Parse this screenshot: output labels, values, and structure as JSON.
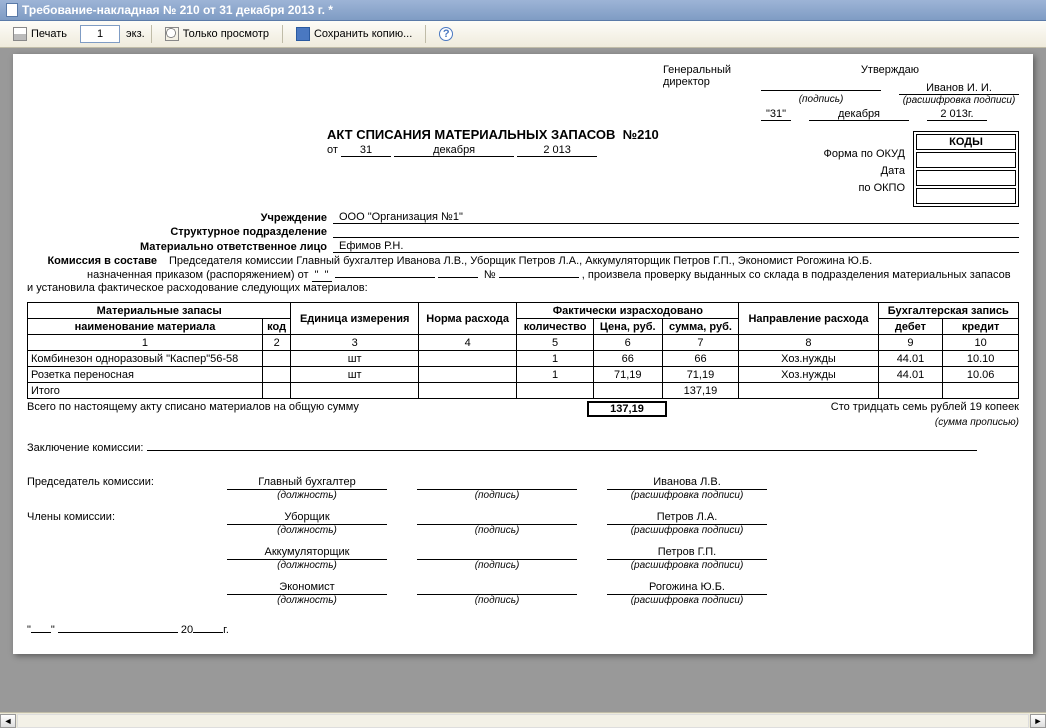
{
  "window": {
    "title": "Требование-накладная № 210 от 31 декабря 2013 г. *"
  },
  "toolbar": {
    "print": "Печать",
    "copies": "1",
    "copies_suffix": "экз.",
    "view_only": "Только просмотр",
    "save_copy": "Сохранить копию...",
    "help": "?"
  },
  "approval": {
    "approve": "Утверждаю",
    "position": "Генеральный\nдиректор",
    "name": "Иванов И. И.",
    "sig_hint": "(подпись)",
    "name_hint": "(расшифровка подписи)",
    "day": "\"31\"",
    "month": "декабря",
    "year": "2 013г."
  },
  "codes": {
    "header": "КОДЫ",
    "okud_label": "Форма по ОКУД",
    "date_label": "Дата",
    "okpo_label": "по ОКПО",
    "okud": "",
    "date": "",
    "okpo": ""
  },
  "act": {
    "title": "АКТ СПИСАНИЯ МАТЕРИАЛЬНЫХ ЗАПАСОВ",
    "number_prefix": "№",
    "number": "210",
    "from": "от",
    "day": "31",
    "month": "декабря",
    "year": "2 013",
    "org_label": "Учреждение",
    "org": "ООО \"Организация №1\"",
    "dept_label": "Структурное подразделение",
    "dept": "",
    "resp_label": "Материально ответственное лицо",
    "resp": "Ефимов Р.Н.",
    "commission_label": "Комиссия в составе",
    "commission": "Председателя комиссии Главный бухгалтер Иванова Л.В., Уборщик Петров Л.А., Аккумуляторщик Петров Г.П., Экономист Рогожина Ю.Б.",
    "order_prefix": "назначенная приказом (распоряжением) от",
    "order_no_prefix": "№",
    "order_tail": ", произвела проверку выданных со склада в подразделения материальных запасов и установила фактическое расходование следующих материалов:"
  },
  "table": {
    "headers": {
      "group_stock": "Материальные запасы",
      "name": "наименование материала",
      "code": "код",
      "unit": "Единица измерения",
      "norm": "Норма расхода",
      "group_fact": "Фактически израсходовано",
      "qty": "количество",
      "price": "Цена, руб.",
      "sum": "сумма, руб.",
      "direction": "Направление расхода",
      "group_acc": "Бухгалтерская запись",
      "debit": "дебет",
      "credit": "кредит"
    },
    "cols": [
      "1",
      "2",
      "3",
      "4",
      "5",
      "6",
      "7",
      "8",
      "9",
      "10"
    ],
    "rows": [
      {
        "name": "Комбинезон одноразовый \"Каспер\"56-58",
        "code": "",
        "unit": "шт",
        "norm": "",
        "qty": "1",
        "price": "66",
        "sum": "66",
        "dir": "Хоз.нужды",
        "debit": "44.01",
        "credit": "10.10"
      },
      {
        "name": "Розетка переносная",
        "code": "",
        "unit": "шт",
        "norm": "",
        "qty": "1",
        "price": "71,19",
        "sum": "71,19",
        "dir": "Хоз.нужды",
        "debit": "44.01",
        "credit": "10.06"
      }
    ],
    "total_label": "Итого",
    "total_sum": "137,19"
  },
  "summary": {
    "line": "Всего по настоящему акту списано материалов на общую сумму",
    "amount": "137,19",
    "words": "Сто тридцать семь рублей 19 копеек",
    "words_hint": "(сумма прописью)",
    "conclusion_label": "Заключение комиссии:"
  },
  "signatures": {
    "chair_label": "Председатель комиссии:",
    "members_label": "Члены комиссии:",
    "pos_hint": "(должность)",
    "sig_hint": "(подпись)",
    "name_hint": "(расшифровка подписи)",
    "rows": [
      {
        "pos": "Главный бухгалтер",
        "name": "Иванова Л.В."
      },
      {
        "pos": "Уборщик",
        "name": "Петров Л.А."
      },
      {
        "pos": "Аккумуляторщик",
        "name": "Петров Г.П."
      },
      {
        "pos": "Экономист",
        "name": "Рогожина Ю.Б."
      }
    ],
    "footer_year_suffix": "г."
  }
}
